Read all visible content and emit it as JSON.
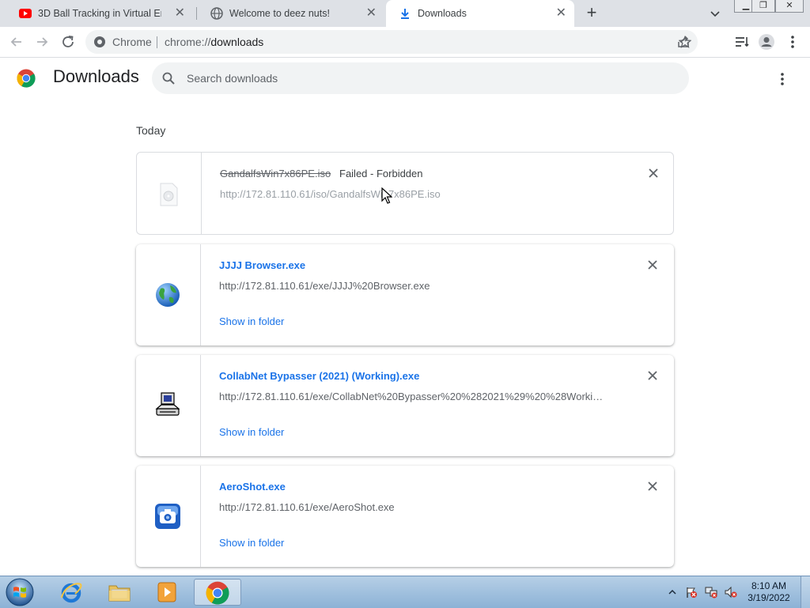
{
  "tabs": [
    {
      "title": "3D Ball Tracking in Virtual Enviro",
      "icon": "youtube-icon",
      "active": false
    },
    {
      "title": "Welcome to deez nuts!",
      "icon": "globe-icon",
      "active": false
    },
    {
      "title": "Downloads",
      "icon": "download-icon",
      "active": true
    }
  ],
  "toolbar": {
    "chip": "Chrome",
    "url_prefix": "chrome://",
    "url_path": "downloads"
  },
  "page": {
    "title": "Downloads",
    "search_placeholder": "Search downloads"
  },
  "section_label": "Today",
  "downloads": [
    {
      "filename": "GandalfsWin7x86PE.iso",
      "status": "Failed - Forbidden",
      "url": "http://172.81.110.61/iso/GandalfsWin7x86PE.iso",
      "icon": "file-icon"
    },
    {
      "filename": "JJJJ Browser.exe",
      "url": "http://172.81.110.61/exe/JJJJ%20Browser.exe",
      "action": "Show in folder",
      "icon": "globe-icon"
    },
    {
      "filename": "CollabNet Bypasser (2021) (Working).exe",
      "url": "http://172.81.110.61/exe/CollabNet%20Bypasser%20%282021%29%20%28Working...",
      "action": "Show in folder",
      "icon": "computer-icon"
    },
    {
      "filename": "AeroShot.exe",
      "url": "http://172.81.110.61/exe/AeroShot.exe",
      "action": "Show in folder",
      "icon": "camera-icon"
    }
  ],
  "taskbar": {
    "time": "8:10 AM",
    "date": "3/19/2022"
  },
  "colors": {
    "accent": "#1a73e8",
    "tabstrip": "#dee1e6",
    "omnibox": "#f1f3f4"
  }
}
